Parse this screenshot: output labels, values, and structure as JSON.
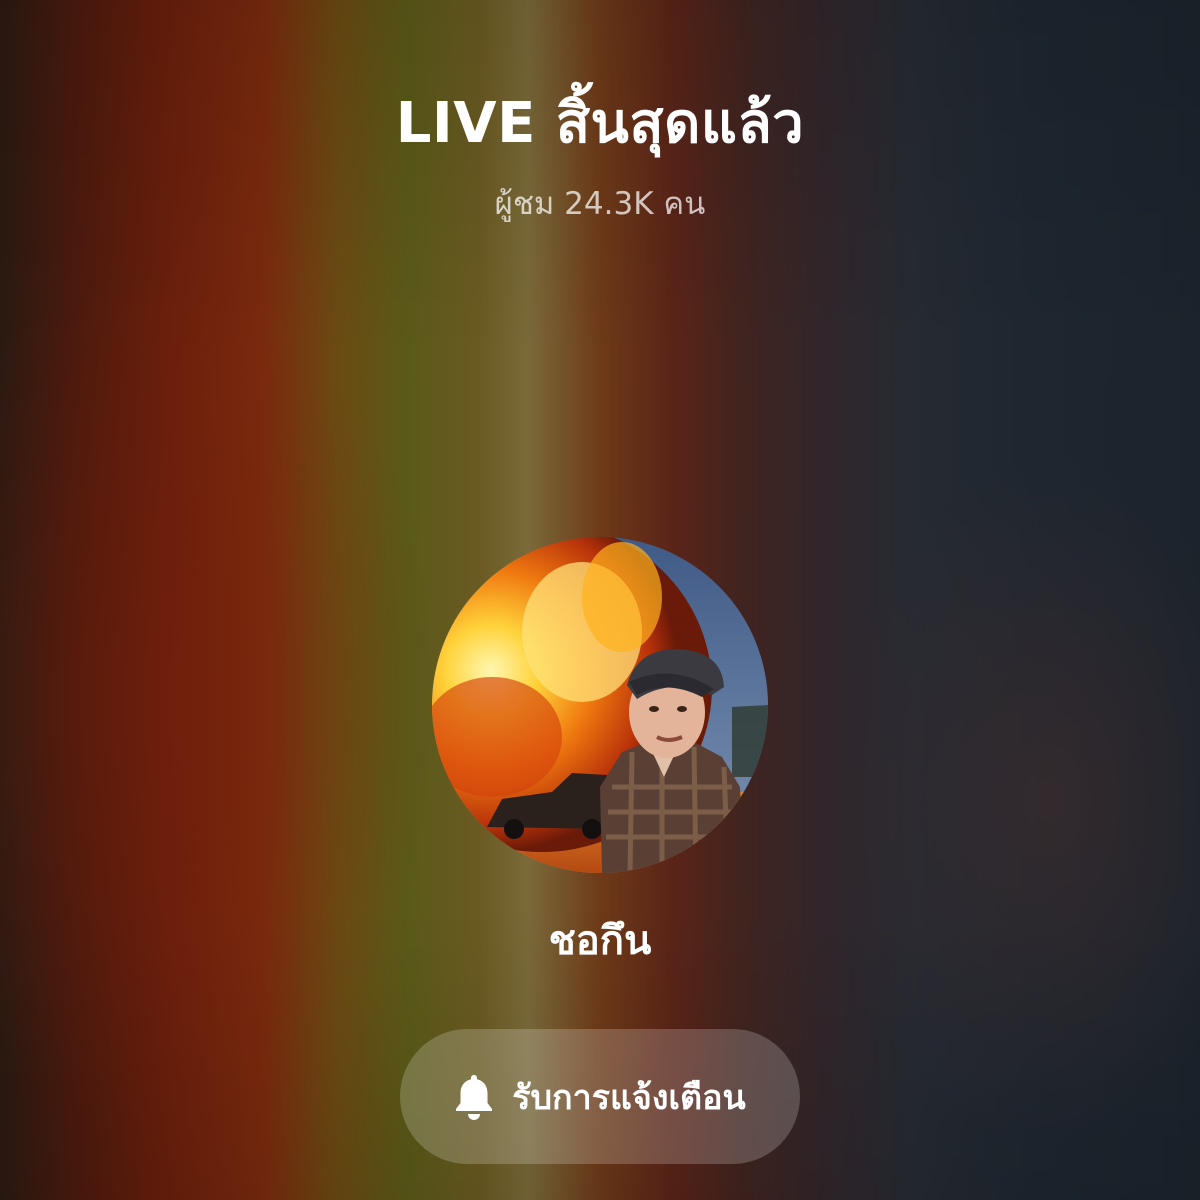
{
  "live_end": {
    "title": "LIVE สิ้นสุดแล้ว",
    "viewers": "ผู้ชม 24.3K คน"
  },
  "host": {
    "username": "ชอกึน"
  },
  "notify_button": {
    "label": "รับการแจ้งเตือน",
    "icon": "bell-icon"
  }
}
